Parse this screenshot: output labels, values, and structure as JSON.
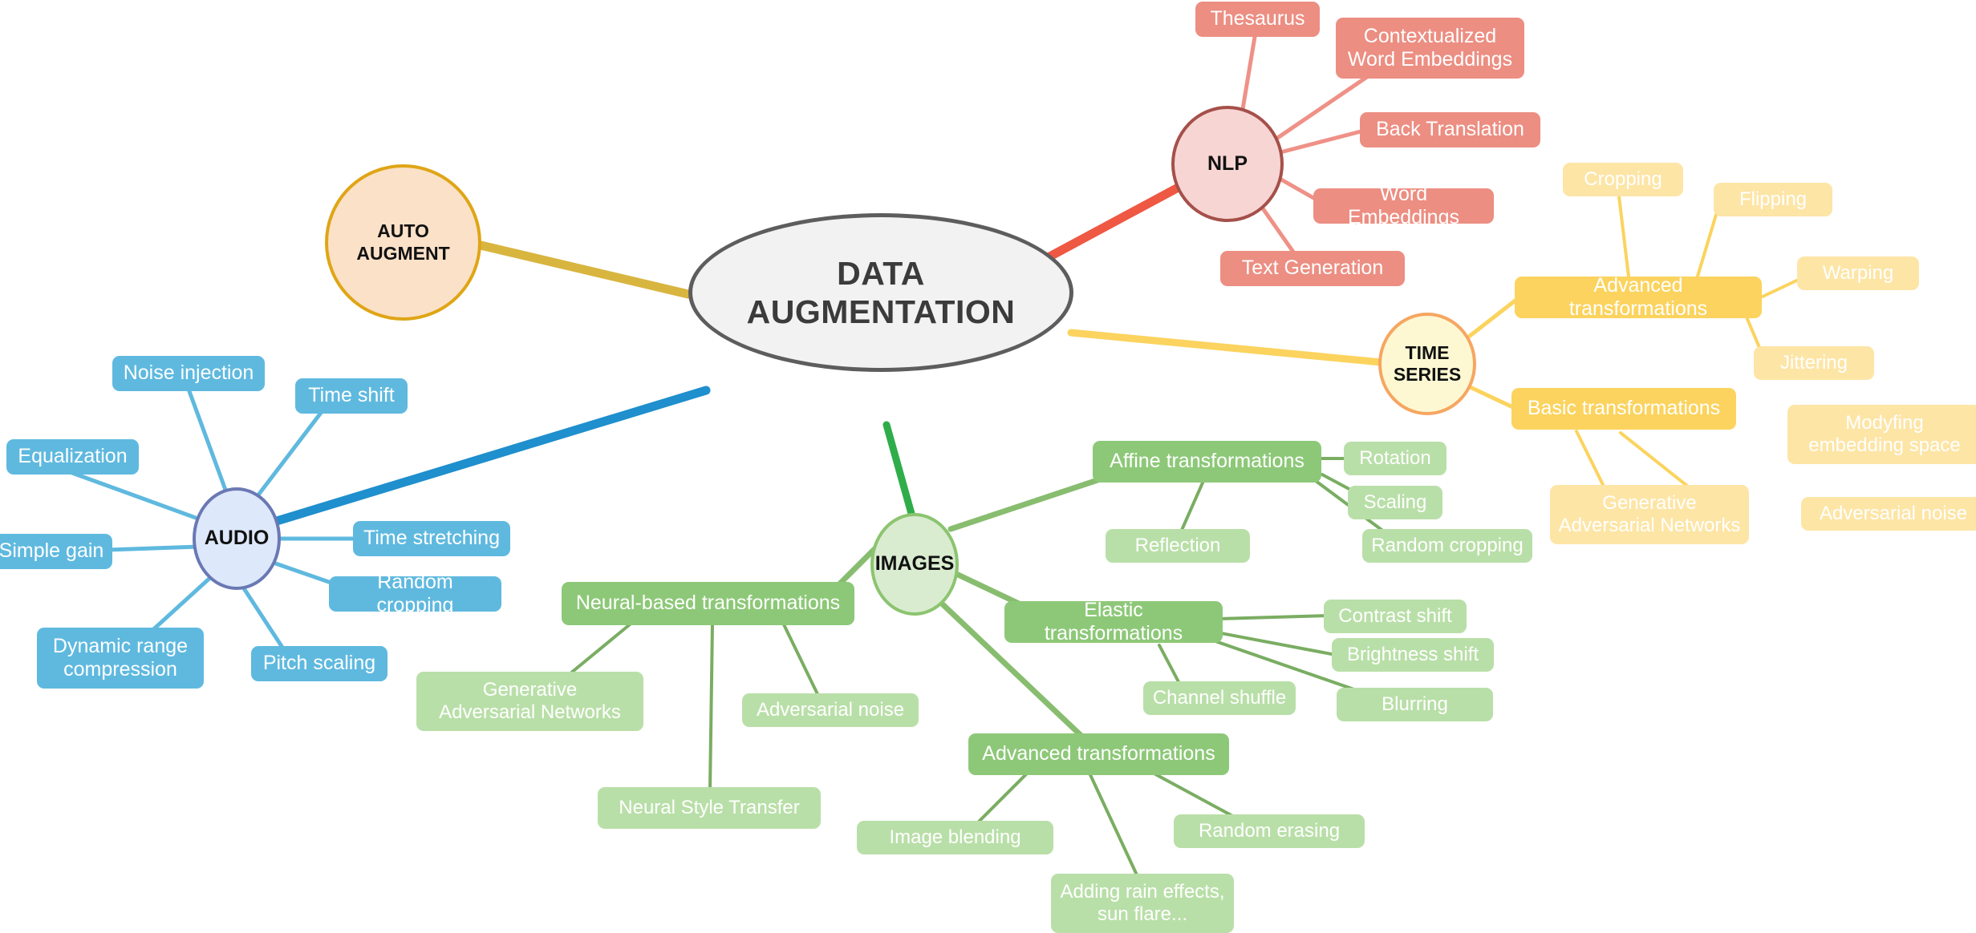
{
  "diagram": {
    "title": "DATA AUGMENTATION",
    "type": "mind-map",
    "root": {
      "label": "DATA\nAUGMENTATION",
      "shape": "ellipse",
      "fill": "#f2f2f2",
      "stroke": "#5d5d5d"
    },
    "branches": [
      {
        "key": "auto_augment",
        "hub": {
          "label": "AUTO\nAUGMENT",
          "shape": "circle",
          "fill": "#fbe1c8",
          "stroke": "#dfa516"
        },
        "edge_color": "#d8b53f",
        "children": []
      },
      {
        "key": "nlp",
        "hub": {
          "label": "NLP",
          "shape": "circle",
          "fill": "#f7d5d3",
          "stroke": "#a5504a"
        },
        "edge_color": "#ef5843",
        "leaf_color": "#ec8e82",
        "children": [
          {
            "label": "Thesaurus"
          },
          {
            "label": "Contextualized\nWord Embeddings"
          },
          {
            "label": "Back Translation"
          },
          {
            "label": "Word Embeddings"
          },
          {
            "label": "Text Generation"
          }
        ]
      },
      {
        "key": "audio",
        "hub": {
          "label": "AUDIO",
          "shape": "circle",
          "fill": "#dde8fa",
          "stroke": "#6a79b4"
        },
        "edge_color": "#1f8fcd",
        "leaf_color": "#5fb9df",
        "children": [
          {
            "label": "Noise injection"
          },
          {
            "label": "Time shift"
          },
          {
            "label": "Equalization"
          },
          {
            "label": "Simple gain"
          },
          {
            "label": "Time stretching"
          },
          {
            "label": "Random cropping"
          },
          {
            "label": "Dynamic range\ncompression"
          },
          {
            "label": "Pitch scaling"
          }
        ]
      },
      {
        "key": "images",
        "hub": {
          "label": "IMAGES",
          "shape": "circle",
          "fill": "#d9ecd0",
          "stroke": "#8cc46f"
        },
        "edge_color": "#2fad4a",
        "parent_color": "#8dc878",
        "leaf_color": "#b9dfa8",
        "children": [
          {
            "label": "Affine transformations",
            "children": [
              {
                "label": "Rotation"
              },
              {
                "label": "Scaling"
              },
              {
                "label": "Random cropping"
              },
              {
                "label": "Reflection"
              }
            ]
          },
          {
            "label": "Elastic transformations",
            "children": [
              {
                "label": "Contrast shift"
              },
              {
                "label": "Brightness shift"
              },
              {
                "label": "Blurring"
              },
              {
                "label": "Channel shuffle"
              }
            ]
          },
          {
            "label": "Neural-based transformations",
            "children": [
              {
                "label": "Generative\nAdversarial Networks"
              },
              {
                "label": "Adversarial noise"
              },
              {
                "label": "Neural Style Transfer"
              }
            ]
          },
          {
            "label": "Advanced transformations",
            "children": [
              {
                "label": "Image blending"
              },
              {
                "label": "Random erasing"
              },
              {
                "label": "Adding rain effects,\nsun flare..."
              }
            ]
          }
        ]
      },
      {
        "key": "time_series",
        "hub": {
          "label": "TIME\nSERIES",
          "shape": "circle",
          "fill": "#fdf8d2",
          "stroke": "#f6a661"
        },
        "edge_color": "#fbd35e",
        "parent_color": "#fbd35e",
        "leaf_color": "#fde5a6",
        "children": [
          {
            "label": "Advanced transformations",
            "children": [
              {
                "label": "Cropping"
              },
              {
                "label": "Flipping"
              },
              {
                "label": "Warping"
              },
              {
                "label": "Jittering"
              }
            ]
          },
          {
            "label": "Basic transformations",
            "children": [
              {
                "label": "Modyfing\nembedding space"
              },
              {
                "label": "Generative\nAdversarial Networks"
              },
              {
                "label": "Adversarial noise"
              }
            ]
          }
        ]
      }
    ]
  }
}
